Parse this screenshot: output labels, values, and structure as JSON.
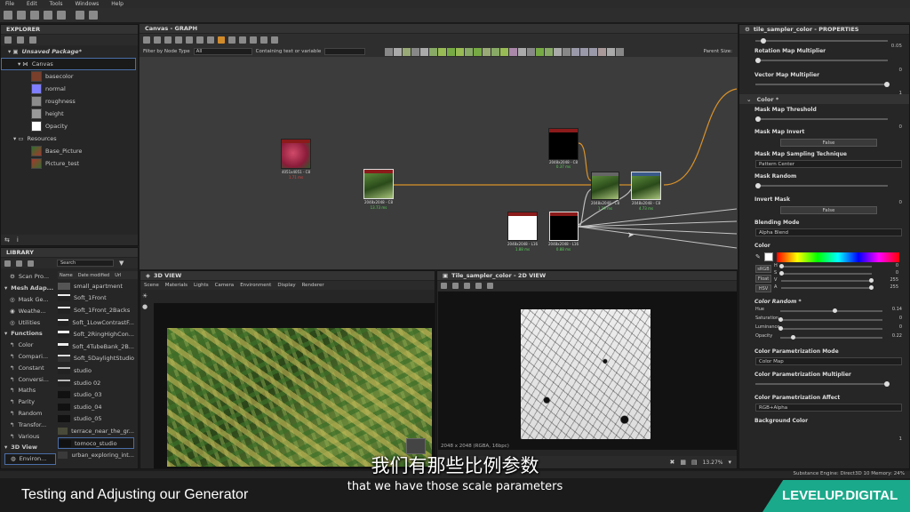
{
  "menu": [
    "File",
    "Edit",
    "Tools",
    "Windows",
    "Help"
  ],
  "explorer": {
    "title": "EXPLORER",
    "package": "Unsaved Package*",
    "canvas": "Canvas",
    "outputs": [
      {
        "label": "basecolor",
        "color": "#7a3f2a"
      },
      {
        "label": "normal",
        "color": "#7f7fff"
      },
      {
        "label": "roughness",
        "color": "#8c8c8c"
      },
      {
        "label": "height",
        "color": "#9a9a9a"
      },
      {
        "label": "Opacity",
        "color": "#ffffff"
      }
    ],
    "resources": "Resources",
    "resource_items": [
      "Base_Picture",
      "Picture_test"
    ]
  },
  "library": {
    "title": "LIBRARY",
    "search_placeholder": "Search",
    "columns": [
      "Name",
      "Date modified",
      "Url"
    ],
    "categories": [
      "Scan Pro...",
      "Mesh Adap...",
      "Mask Ge...",
      "Weathe...",
      "Utilities",
      "Functions",
      "Color",
      "Compari...",
      "Constant",
      "Conversi...",
      "Maths",
      "Parity",
      "Random",
      "Transfor...",
      "Various",
      "3D View",
      "Environ..."
    ],
    "items": [
      "small_apartment",
      "Soft_1Front",
      "Soft_1Front_2Backs",
      "Soft_1LowContrastF...",
      "Soft_2RingHighCon...",
      "Soft_4TubeBank_2B...",
      "Soft_5DaylightStudio",
      "studio",
      "studio 02",
      "studio_03",
      "studio_04",
      "studio_05",
      "terrace_near_the_gr...",
      "tomoco_studio",
      "urban_exploring_int..."
    ]
  },
  "graph": {
    "title": "Canvas - GRAPH",
    "filter_label": "Filter by Node Type",
    "filter_value": "All",
    "contains_label": "Containing text or variable",
    "parent_size": "Parent Size:",
    "nodes": [
      {
        "name": "Bitmap",
        "res": "4051x4051 - C8",
        "time": "1.71 ms"
      },
      {
        "name": "Uniform Color",
        "res": "2048x2048 - C8",
        "time": "0.37 ms"
      },
      {
        "name": "Bitmap",
        "res": "2048x2048 - C8",
        "time": "13.73 ms"
      },
      {
        "name": "Blend",
        "res": "2048x2048 - C8",
        "time": "1.19 ms"
      },
      {
        "name": "Tile Sampler",
        "res": "2048x2048 - C8",
        "time": "4.73 ms"
      },
      {
        "name": "Shape",
        "res": "2048x2048 - L16",
        "time": "1.88 ms"
      },
      {
        "name": "Tile Generator",
        "res": "2048x2048 - L16",
        "time": "0.88 ms"
      }
    ]
  },
  "view3d": {
    "title": "3D VIEW",
    "menu": [
      "Scene",
      "Materials",
      "Lights",
      "Camera",
      "Environment",
      "Display",
      "Renderer"
    ]
  },
  "view2d": {
    "title": "Tile_sampler_color - 2D VIEW",
    "info": "2048 x 2048 (RGBA, 16bpc)",
    "zoom": "13.27%"
  },
  "props": {
    "title": "tile_sampler_color - PROPERTIES",
    "rotation_random_val": "0.05",
    "rotation_map_mult": "Rotation Map Multiplier",
    "rotation_map_mult_val": "0",
    "vector_map_mult": "Vector Map Multiplier",
    "vector_map_mult_val": "1",
    "section_color": "Color *",
    "mask_threshold": "Mask Map Threshold",
    "mask_threshold_val": "0",
    "mask_invert": "Mask Map Invert",
    "false_label": "False",
    "mask_sampling": "Mask Map Sampling Technique",
    "mask_sampling_val": "Pattern Center",
    "mask_random": "Mask Random",
    "mask_random_val": "0",
    "invert_mask": "Invert Mask",
    "blending_mode": "Blending Mode",
    "blending_mode_val": "Alpha Blend",
    "color": "Color",
    "color_modes": [
      "sRGB",
      "Float",
      "HSV"
    ],
    "hsva": [
      {
        "k": "H",
        "v": "0"
      },
      {
        "k": "S",
        "v": "0"
      },
      {
        "k": "V",
        "v": "255"
      },
      {
        "k": "A",
        "v": "255"
      }
    ],
    "color_random": "Color Random *",
    "color_random_rows": [
      {
        "k": "Hue",
        "v": "0.14"
      },
      {
        "k": "Saturation",
        "v": "0"
      },
      {
        "k": "Luminance",
        "v": "0"
      },
      {
        "k": "Opacity",
        "v": "0.22"
      }
    ],
    "color_param_mode": "Color Parametrization Mode",
    "color_param_mode_val": "Color Map",
    "color_param_mult": "Color Parametrization Multiplier",
    "color_param_mult_val": "1",
    "color_param_affect": "Color Parametrization Affect",
    "color_param_affect_val": "RGB+Alpha",
    "background_color": "Background Color"
  },
  "status": "Substance Engine: Direct3D 10  Memory: 24%",
  "caption": {
    "chinese": "我们有那些比例参数",
    "english": "that we have those scale parameters",
    "lesson": "Testing and Adjusting our Generator",
    "brand": "LEVELUP.DIGITAL"
  }
}
